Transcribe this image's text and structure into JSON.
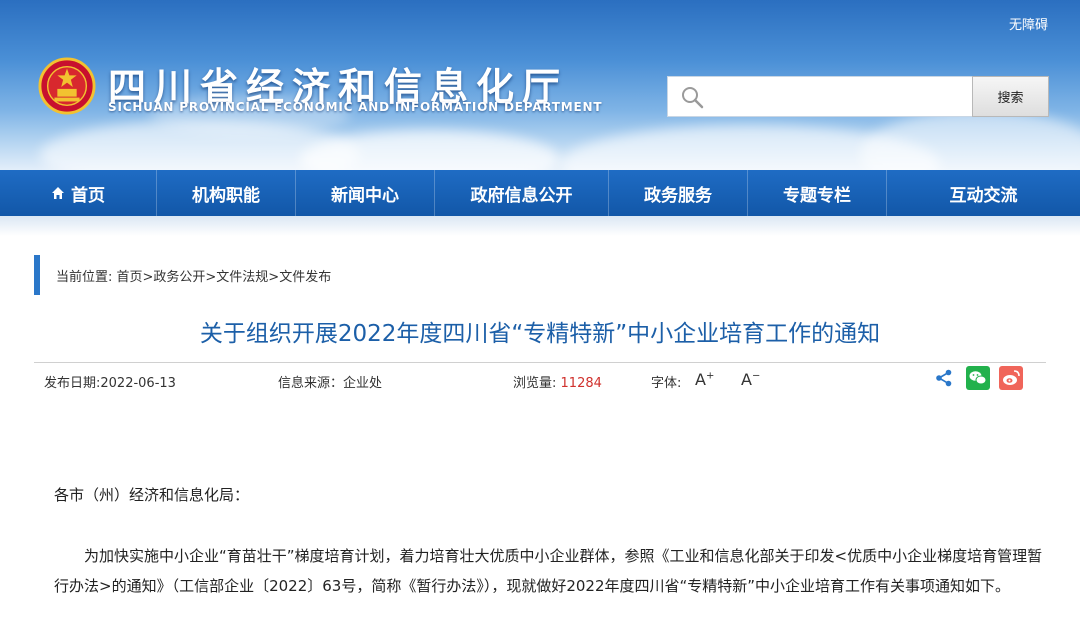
{
  "header": {
    "accessibility_link": "无障碍",
    "title_cn": "四川省经济和信息化厅",
    "title_en": "SICHUAN PROVINCIAL ECONOMIC AND INFORMATION DEPARTMENT",
    "search": {
      "placeholder": "",
      "button_label": "搜索"
    }
  },
  "nav": {
    "items": [
      {
        "label": "首页"
      },
      {
        "label": "机构职能"
      },
      {
        "label": "新闻中心"
      },
      {
        "label": "政府信息公开"
      },
      {
        "label": "政务服务"
      },
      {
        "label": "专题专栏"
      },
      {
        "label": "互动交流"
      }
    ]
  },
  "breadcrumb": {
    "text": "当前位置: 首页>政务公开>文件法规>文件发布"
  },
  "article": {
    "title": "关于组织开展2022年度四川省“专精特新”中小企业培育工作的通知",
    "meta": {
      "date_label": "发布日期:",
      "date": "2022-06-13",
      "source_label": "信息来源：",
      "source": "企业处",
      "views_label": "浏览量:",
      "views": "11284",
      "font_label": "字体:",
      "font_increase": "A",
      "font_decrease": "A"
    },
    "salutation": "各市（州）经济和信息化局：",
    "paragraph": "为加快实施中小企业“育苗壮干”梯度培育计划，着力培育壮大优质中小企业群体，参照《工业和信息化部关于印发<优质中小企业梯度培育管理暂行办法>的通知》（工信部企业〔2022〕63号，简称《暂行办法》），现就做好2022年度四川省“专精特新”中小企业培育工作有关事项通知如下。"
  },
  "colors": {
    "nav_bg": "#1a64b8",
    "title_blue": "#1c5fa8",
    "views_red": "#d0312d",
    "wechat_green": "#22b14c",
    "weibo_red": "#f0655a"
  }
}
